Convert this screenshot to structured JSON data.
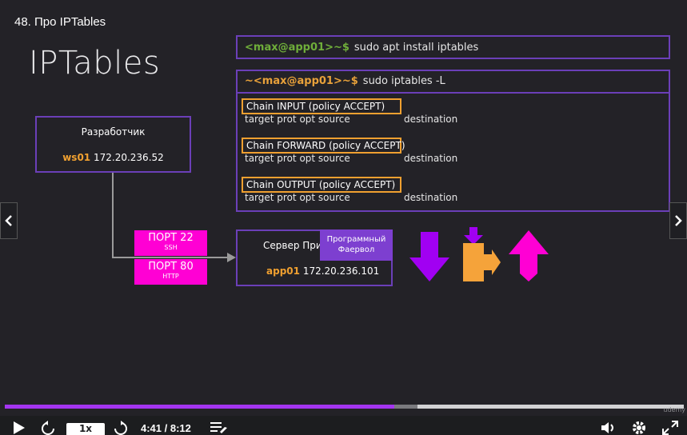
{
  "lesson": {
    "title": "48. Про IPTables"
  },
  "slide": {
    "heading": "IPTables",
    "terminal1": {
      "prompt": "<max@app01>~$",
      "command": "sudo  apt  install  iptables"
    },
    "terminal2": {
      "prompt": "~<max@app01>~$",
      "command": "sudo  iptables  -L",
      "chains": [
        {
          "name": "Chain INPUT (policy ACCEPT)",
          "header": "target     prot opt source",
          "destination": "destination"
        },
        {
          "name": "Chain FORWARD (policy ACCEPT)",
          "header": "target     prot opt source",
          "destination": "destination"
        },
        {
          "name": "Chain OUTPUT (policy ACCEPT)",
          "header": "target     prot opt source",
          "destination": "destination"
        }
      ]
    },
    "developer": {
      "title": "Разработчик",
      "host": "ws01",
      "ip": "172.20.236.52"
    },
    "server": {
      "title": "Сервер При",
      "host": "app01",
      "ip": "172.20.236.101"
    },
    "firewall": {
      "line1": "Программный",
      "line2": "Фаервол"
    },
    "ports": [
      {
        "label": "ПОРТ 22",
        "sub": "SSH"
      },
      {
        "label": "ПОРТ 80",
        "sub": "HTTP"
      }
    ],
    "colors": {
      "accent": "#6b3fb8",
      "chain": "#f0a030",
      "port": "#ff00d4",
      "input_arrow": "#a100f2",
      "forward_arrow": "#f5a33a",
      "output_arrow": "#ff00d4"
    }
  },
  "player": {
    "speed": "1x",
    "time": "4:41 / 8:12",
    "progress": 0.574,
    "buffered": 0.608,
    "watermark": "udemy"
  }
}
